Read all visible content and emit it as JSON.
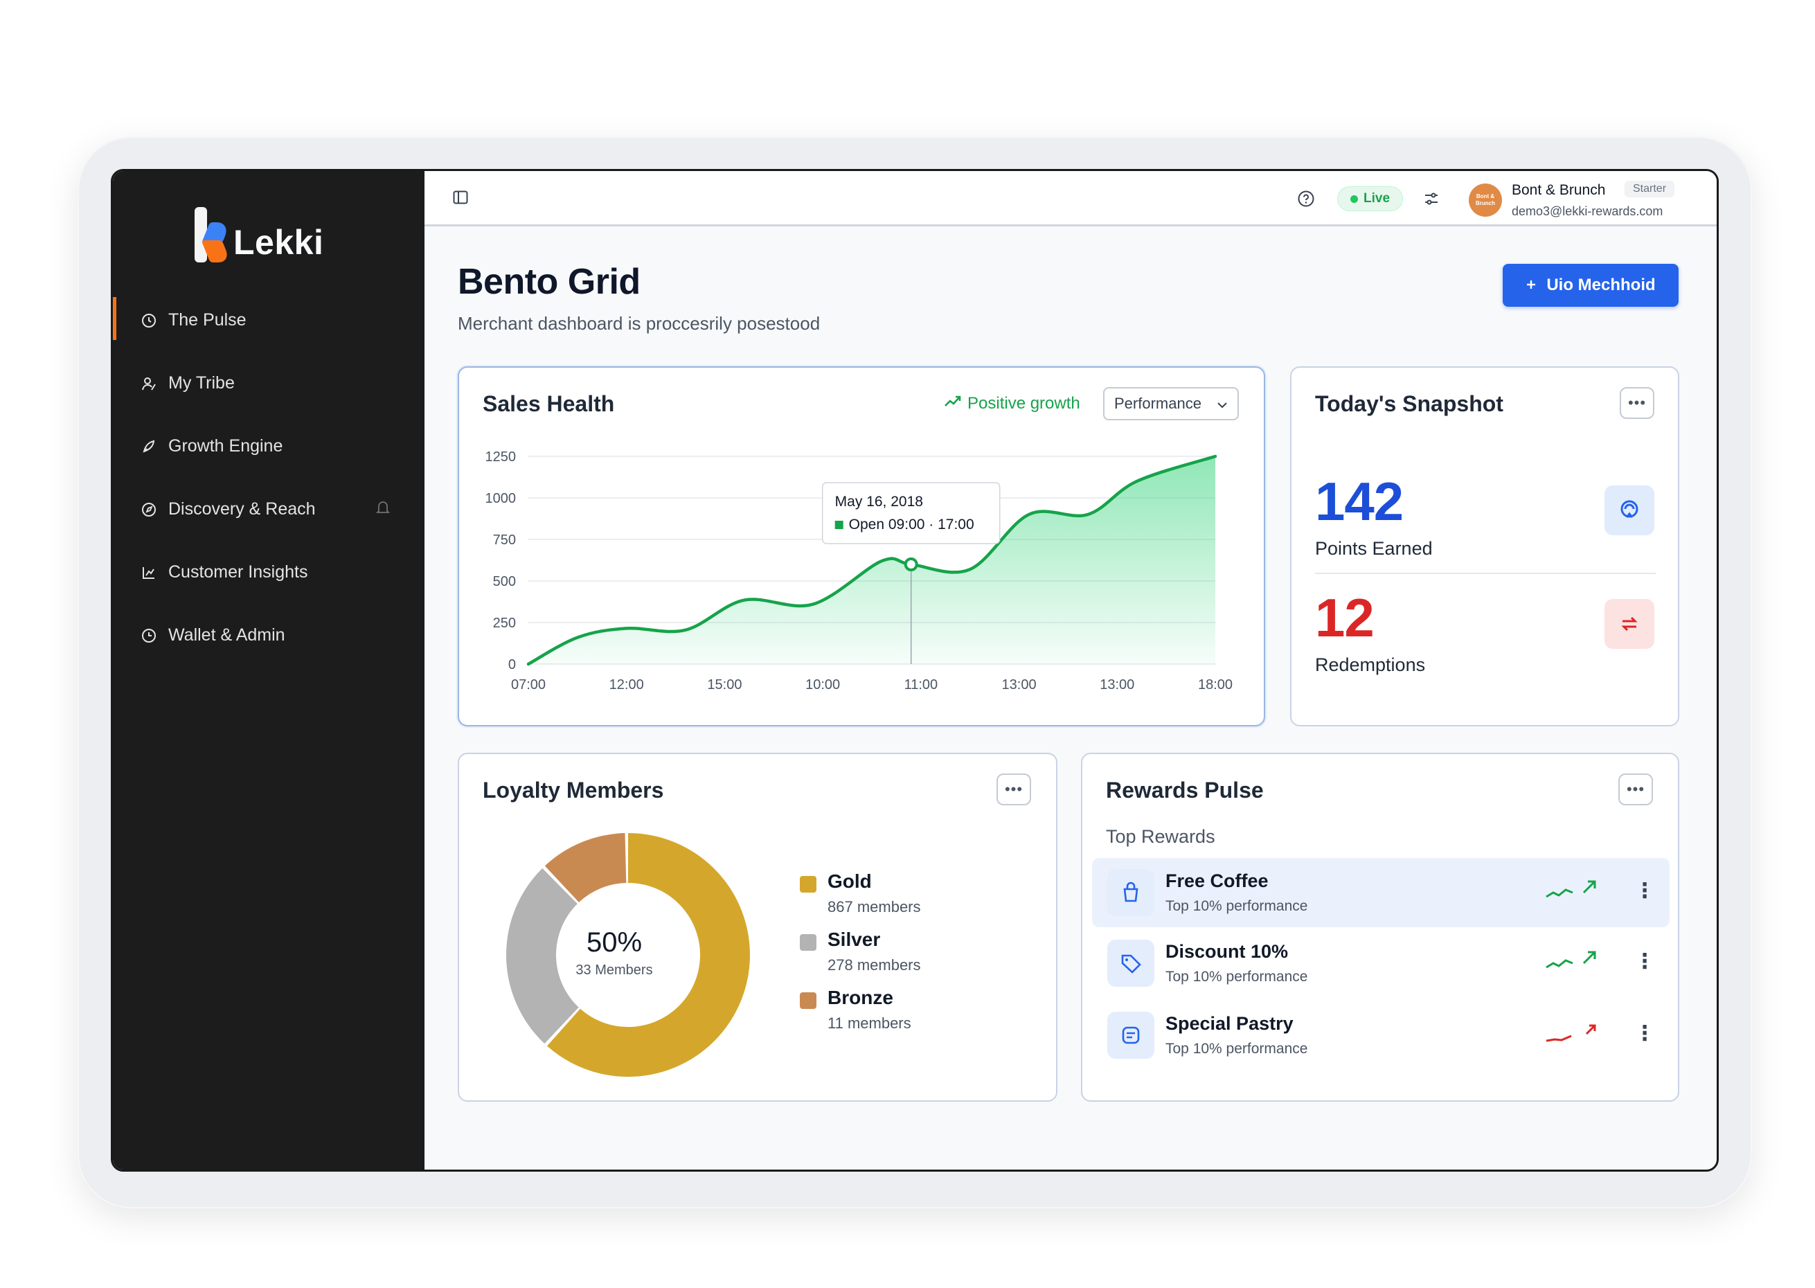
{
  "app": {
    "name": "Lekki",
    "colors": {
      "accent": "#2563eb",
      "brand_orange": "#f97316",
      "success": "#16a34a",
      "danger": "#dc2626",
      "sidebar_bg": "#1c1c1c"
    }
  },
  "sidebar": {
    "items": [
      {
        "label": "The Pulse",
        "icon": "pulse-icon",
        "active": true
      },
      {
        "label": "My Tribe",
        "icon": "tribe-icon"
      },
      {
        "label": "Growth Engine",
        "icon": "rocket-icon"
      },
      {
        "label": "Discovery & Reach",
        "icon": "compass-icon",
        "trailing_icon": "bell-icon"
      },
      {
        "label": "Customer Insights",
        "icon": "chart-icon"
      },
      {
        "label": "Wallet & Admin",
        "icon": "wallet-icon"
      }
    ]
  },
  "topbar": {
    "status": "Live",
    "account": {
      "name": "Bont & Brunch",
      "plan": "Starter",
      "email": "demo3@lekki-rewards.com",
      "avatar_text": "Bont & Brunch"
    }
  },
  "page": {
    "title": "Bento Grid",
    "subtitle": "Merchant dashboard is proccesrily posestood",
    "primary_button": "Uio Mechhoid"
  },
  "sales_health": {
    "title": "Sales Health",
    "trend_label": "Positive growth",
    "range": "Performance",
    "tooltip": {
      "date": "May 16, 2018",
      "value": "Open 09:00 · 17:00"
    }
  },
  "snapshot": {
    "title": "Today's Snapshot",
    "metrics": [
      {
        "value": "142",
        "label": "Points Earned",
        "color": "#1d4ed8",
        "icon": "points-icon"
      },
      {
        "value": "12",
        "label": "Redemptions",
        "color": "#dc2626",
        "icon": "redeem-icon"
      }
    ]
  },
  "loyalty": {
    "title": "Loyalty Members",
    "center_value": "50%",
    "center_label": "33 Members",
    "tiers": [
      {
        "name": "Gold",
        "count": "867 members",
        "value": 62,
        "color": "#d4a72c"
      },
      {
        "name": "Silver",
        "count": "278 members",
        "value": 26,
        "color": "#b3b3b3"
      },
      {
        "name": "Bronze",
        "count": "11 members",
        "value": 12,
        "color": "#c98a52"
      }
    ]
  },
  "rewards": {
    "title": "Rewards Pulse",
    "section_label": "Top Rewards",
    "items": [
      {
        "name": "Free Coffee",
        "subtitle": "Top 10% performance",
        "icon": "cup-icon",
        "trend": "up",
        "highlight": true
      },
      {
        "name": "Discount 10%",
        "subtitle": "Top 10% performance",
        "icon": "tag-icon",
        "trend": "up"
      },
      {
        "name": "Special Pastry",
        "subtitle": "Top 10% performance",
        "icon": "pastry-icon",
        "trend": "down"
      }
    ]
  },
  "chart_data": {
    "type": "area",
    "title": "Sales Health",
    "x": [
      "07:00",
      "12:00",
      "15:00",
      "10:00",
      "11:00",
      "13:00",
      "13:00",
      "18:00"
    ],
    "y_ticks": [
      "0",
      "250",
      "500",
      "750",
      "1000",
      "1250"
    ],
    "ylim": [
      0,
      1250
    ],
    "grid": true,
    "series": [
      {
        "points": [
          [
            0.0,
            0
          ],
          [
            0.5,
            160
          ],
          [
            1.0,
            215
          ],
          [
            1.6,
            205
          ],
          [
            2.2,
            385
          ],
          [
            2.9,
            360
          ],
          [
            3.6,
            620
          ],
          [
            3.9,
            600
          ],
          [
            4.5,
            570
          ],
          [
            5.1,
            900
          ],
          [
            5.7,
            900
          ],
          [
            6.2,
            1100
          ],
          [
            7.0,
            1250
          ]
        ],
        "color": "#16a34a"
      }
    ],
    "highlight_index": 7
  }
}
